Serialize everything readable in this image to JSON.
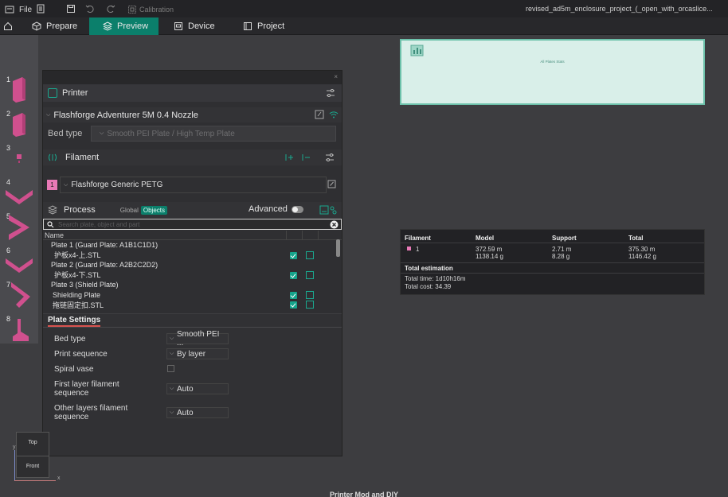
{
  "titlebar": {
    "file_label": "File",
    "calibration_label": "Calibration",
    "project_title": "revised_ad5m_enclosure_project_(_open_with_orcaslice..."
  },
  "tabs": [
    {
      "label": "Prepare",
      "active": false
    },
    {
      "label": "Preview",
      "active": true
    },
    {
      "label": "Device",
      "active": false
    },
    {
      "label": "Project",
      "active": false
    }
  ],
  "thumbnails": {
    "stats_label": "All Plates Stats",
    "plates": [
      "1",
      "2",
      "3",
      "4",
      "5",
      "6",
      "7",
      "8"
    ]
  },
  "printer": {
    "section_label": "Printer",
    "name": "Flashforge Adventurer 5M 0.4 Nozzle",
    "bed_type_label": "Bed type",
    "bed_type_value": "Smooth PEI Plate / High Temp Plate"
  },
  "filament": {
    "section_label": "Filament",
    "slot_number": "1",
    "slot_color": "#e879b6",
    "name": "Flashforge Generic PETG"
  },
  "process": {
    "section_label": "Process",
    "mode_global": "Global",
    "mode_objects": "Objects",
    "advanced_label": "Advanced",
    "search_placeholder": "Search plate, object and part",
    "column_name": "Name",
    "tree": [
      {
        "text": "Plate 1 (Guard Plate: A1B1C1D1)",
        "indent": false,
        "checked": false
      },
      {
        "text": "护板x4-上.STL",
        "indent": true,
        "checked": true
      },
      {
        "text": "Plate 2 (Guard Plate: A2B2C2D2)",
        "indent": false,
        "checked": false
      },
      {
        "text": "护板x4-下.STL",
        "indent": true,
        "checked": true
      },
      {
        "text": "Plate 3 (Shield Plate)",
        "indent": false,
        "checked": false
      },
      {
        "text": "Shielding Plate",
        "indent": true,
        "checked": true
      },
      {
        "text": "拖链固定扣.STL",
        "indent": true,
        "checked": true
      }
    ]
  },
  "plate_settings": {
    "tab_label": "Plate Settings",
    "bed_type_label": "Bed type",
    "bed_type_value": "Smooth PEI ...",
    "print_sequence_label": "Print sequence",
    "print_sequence_value": "By layer",
    "spiral_vase_label": "Spiral vase",
    "first_layer_label_1": "First layer filament",
    "first_layer_label_2": "sequence",
    "first_layer_value": "Auto",
    "other_layers_label_1": "Other layers filament",
    "other_layers_label_2": "sequence",
    "other_layers_value": "Auto"
  },
  "stats": {
    "headers": {
      "filament": "Filament",
      "model": "Model",
      "support": "Support",
      "total": "Total"
    },
    "row": {
      "slot": "1",
      "model_m": "372.59 m",
      "model_g": "1138.14 g",
      "support_m": "2.71 m",
      "support_g": "8.28 g",
      "total_m": "375.30 m",
      "total_g": "1146.42 g"
    },
    "estimation_title": "Total estimation",
    "total_time": "Total time:  1d10h16m",
    "total_cost": "Total cost:  34.39"
  },
  "navcube": {
    "top": "Top",
    "front": "Front",
    "x": "x",
    "y": "y"
  },
  "footer": {
    "banner_text": "Printer Mod and DIY"
  }
}
